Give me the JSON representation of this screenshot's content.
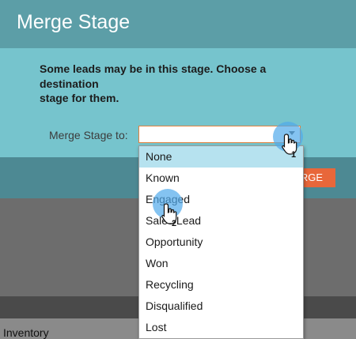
{
  "dialog": {
    "title": "Merge Stage",
    "message_lines": [
      "Some leads may be in this stage. Choose a",
      "destination",
      "stage for them."
    ],
    "field_label": "Merge Stage to:",
    "selected_value": "",
    "merge_button_label": "RGE"
  },
  "dropdown": {
    "options": [
      "None",
      "Known",
      "Engaged",
      "Sales Lead",
      "Opportunity",
      "Won",
      "Recycling",
      "Disqualified",
      "Lost"
    ],
    "highlighted": "None"
  },
  "annotations": {
    "step1": "1",
    "step2": "2"
  },
  "background": {
    "row_label": "Inventory"
  },
  "colors": {
    "header": "#5c9ea7",
    "body": "#76c4cd",
    "footer": "#4d8993",
    "accent": "#e8673a",
    "highlight": "#b6e2ef"
  }
}
